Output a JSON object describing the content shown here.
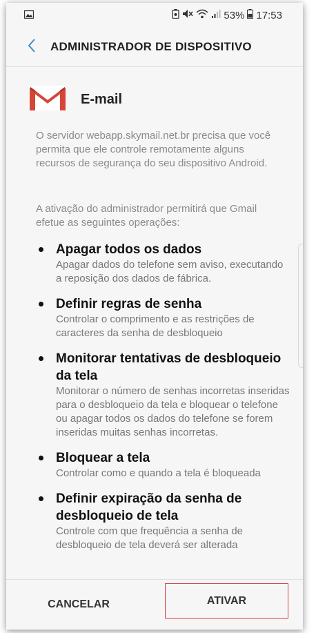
{
  "status": {
    "battery": "53%",
    "time": "17:53"
  },
  "appbar": {
    "title": "ADMINISTRADOR DE DISPOSITIVO"
  },
  "app": {
    "name": "E-mail"
  },
  "paragraphs": {
    "intro": "O servidor webapp.skymail.net.br precisa que você permita que ele controle remotamente alguns recursos de segurança do seu dispositivo Android.",
    "activation": "A ativação do administrador permitirá que Gmail efetue as seguintes operações:"
  },
  "operations": [
    {
      "title": "Apagar todos os dados",
      "description": "Apagar dados do telefone sem aviso, executando a reposição dos dados de fábrica."
    },
    {
      "title": "Definir regras de senha",
      "description": "Controlar o comprimento e as restrições de caracteres da senha de desbloqueio"
    },
    {
      "title": "Monitorar tentativas de desbloqueio da tela",
      "description": "Monitorar o número de senhas incorretas inseridas para o desbloqueio da tela e bloquear o telefone ou apagar todos os dados do telefone se forem inseridas muitas senhas incorretas."
    },
    {
      "title": "Bloquear a tela",
      "description": "Controlar como e quando a tela é bloqueada"
    },
    {
      "title": "Definir expiração da senha de desbloqueio de tela",
      "description": "Controle com que frequência a senha de desbloqueio de tela deverá ser alterada"
    }
  ],
  "buttons": {
    "cancel": "CANCELAR",
    "activate": "ATIVAR"
  },
  "colors": {
    "gmail_red": "#d44638",
    "back_arrow": "#3a8fc7",
    "highlight_border": "#d33b3b"
  }
}
